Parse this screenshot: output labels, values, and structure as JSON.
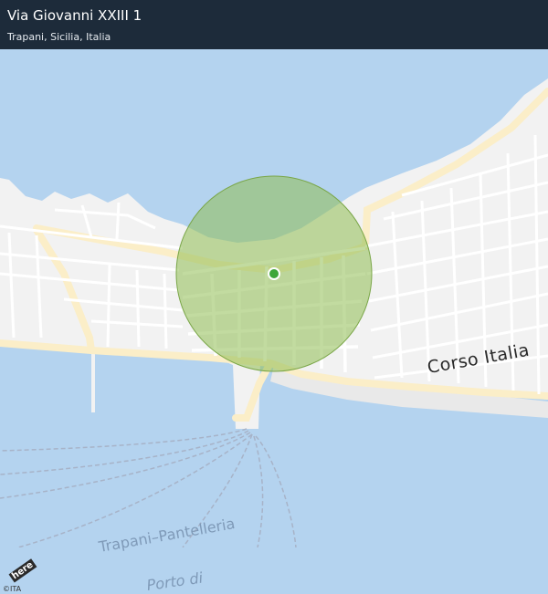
{
  "header": {
    "title": "Via Giovanni XXIII 1",
    "subtitle": "Trapani, Sicilia, Italia"
  },
  "map": {
    "labels": {
      "street": "Corso  Italia",
      "ferry_route": "Trapani–Pantelleria",
      "port": "Porto di"
    },
    "attribution": {
      "logo": "here",
      "copyright": "©ITA"
    },
    "colors": {
      "sea": "#b4d3ef",
      "land": "#f2f2f2",
      "road": "#ffffff",
      "main_road": "#fbeec8",
      "radius_fill": "#8fbe52",
      "marker": "#3da63a"
    }
  }
}
